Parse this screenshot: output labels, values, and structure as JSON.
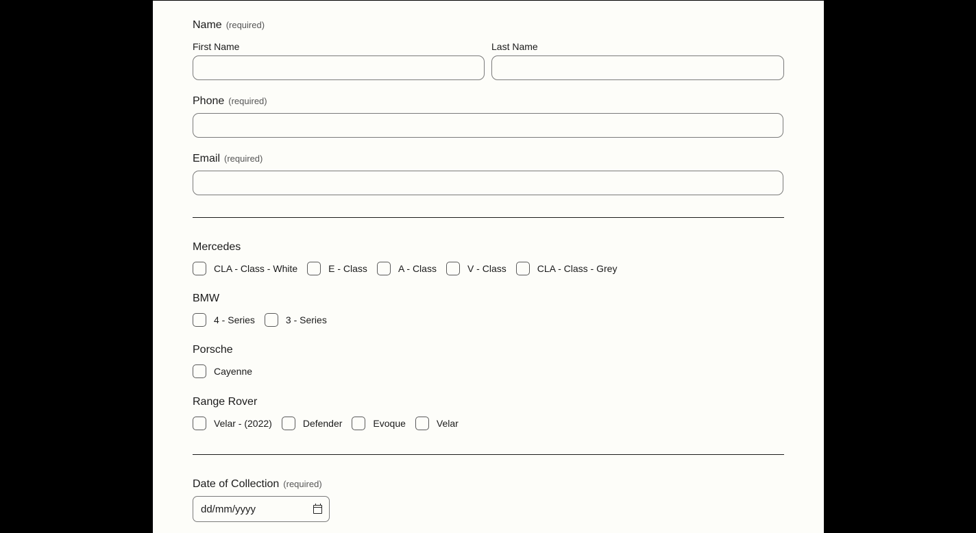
{
  "name_field": {
    "title": "Name",
    "required": "(required)",
    "first_label": "First Name",
    "last_label": "Last Name",
    "first_value": "",
    "last_value": ""
  },
  "phone_field": {
    "title": "Phone",
    "required": "(required)",
    "value": ""
  },
  "email_field": {
    "title": "Email",
    "required": "(required)",
    "value": ""
  },
  "groups": [
    {
      "title": "Mercedes",
      "options": [
        "CLA - Class - White",
        "E - Class",
        "A - Class",
        "V - Class",
        "CLA - Class - Grey"
      ]
    },
    {
      "title": "BMW",
      "options": [
        "4 - Series",
        "3 - Series"
      ]
    },
    {
      "title": "Porsche",
      "options": [
        "Cayenne"
      ]
    },
    {
      "title": "Range Rover",
      "options": [
        "Velar - (2022)",
        "Defender",
        "Evoque",
        "Velar"
      ]
    }
  ],
  "date_field": {
    "title": "Date of Collection",
    "required": "(required)",
    "placeholder": "dd/mm/yyyy",
    "icon": "calendar-icon"
  }
}
